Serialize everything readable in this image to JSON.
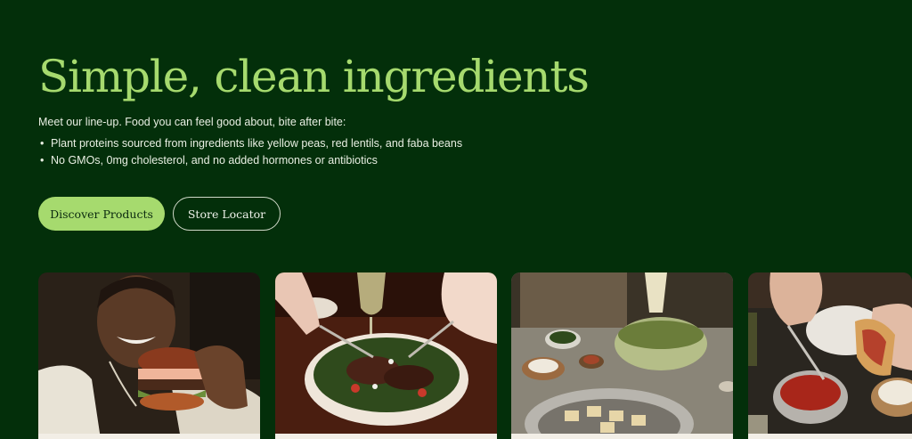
{
  "colors": {
    "background": "#032f0a",
    "accent": "#a6da6e",
    "text": "#e9efe3"
  },
  "hero": {
    "title": "Simple, clean ingredients",
    "intro": "Meet our line-up. Food you can feel good about, bite after bite:",
    "bullets": [
      "Plant proteins sourced from ingredients like yellow peas, red lentils, and faba beans",
      "No GMOs, 0mg cholesterol, and no added hormones or antibiotics"
    ],
    "bullet_marker": "•",
    "buttons": {
      "discover": "Discover Products",
      "store": "Store Locator"
    }
  },
  "cards": [
    {
      "image": "man-eating-burger-photo"
    },
    {
      "image": "steak-salad-bowl-photo"
    },
    {
      "image": "salad-prep-kitchen-photo"
    },
    {
      "image": "tacos-with-salsa-photo"
    }
  ]
}
